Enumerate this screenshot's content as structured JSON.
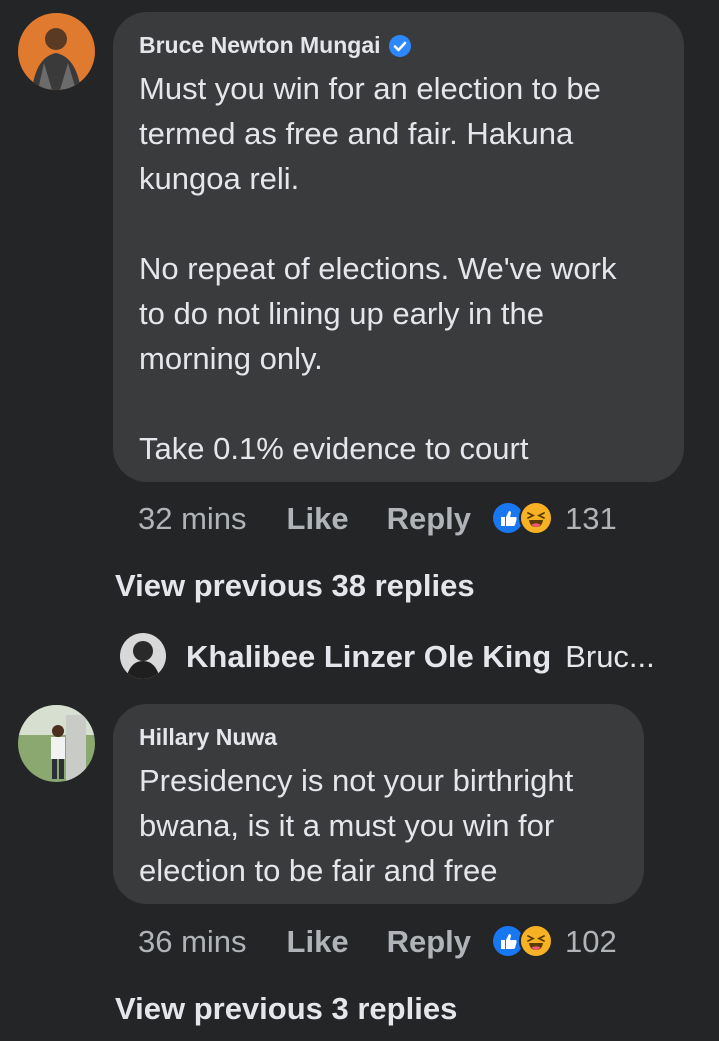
{
  "comments": [
    {
      "author": "Bruce Newton Mungai",
      "verified": true,
      "text": "Must you win for an election to be\ntermed as free and fair. Hakuna\nkungoa reli.\n\nNo repeat of elections. We've work\nto do not lining up early in the\nmorning only.\n\nTake 0.1% evidence to court",
      "time": "32 mins",
      "like_label": "Like",
      "reply_label": "Reply",
      "reaction_count": "131",
      "reactions": [
        "like-icon",
        "haha-icon"
      ],
      "view_previous": "View previous 38 replies",
      "reply_preview": {
        "name": "Khalibee Linzer Ole King",
        "snippet": "Bruc..."
      }
    },
    {
      "author": "Hillary Nuwa",
      "verified": false,
      "text": "Presidency is not your birthright\nbwana, is it a must you win for\nelection to be fair and free",
      "time": "36 mins",
      "like_label": "Like",
      "reply_label": "Reply",
      "reaction_count": "102",
      "reactions": [
        "like-icon",
        "haha-icon"
      ],
      "view_previous": "View previous 3 replies"
    }
  ],
  "colors": {
    "background": "#242526",
    "bubble": "#3a3b3c",
    "primary_text": "#e4e6eb",
    "secondary_text": "#b0b3b8",
    "verified_badge": "#2d88ff",
    "like_reaction": "#1877f2",
    "haha_reaction": "#f7b125"
  }
}
